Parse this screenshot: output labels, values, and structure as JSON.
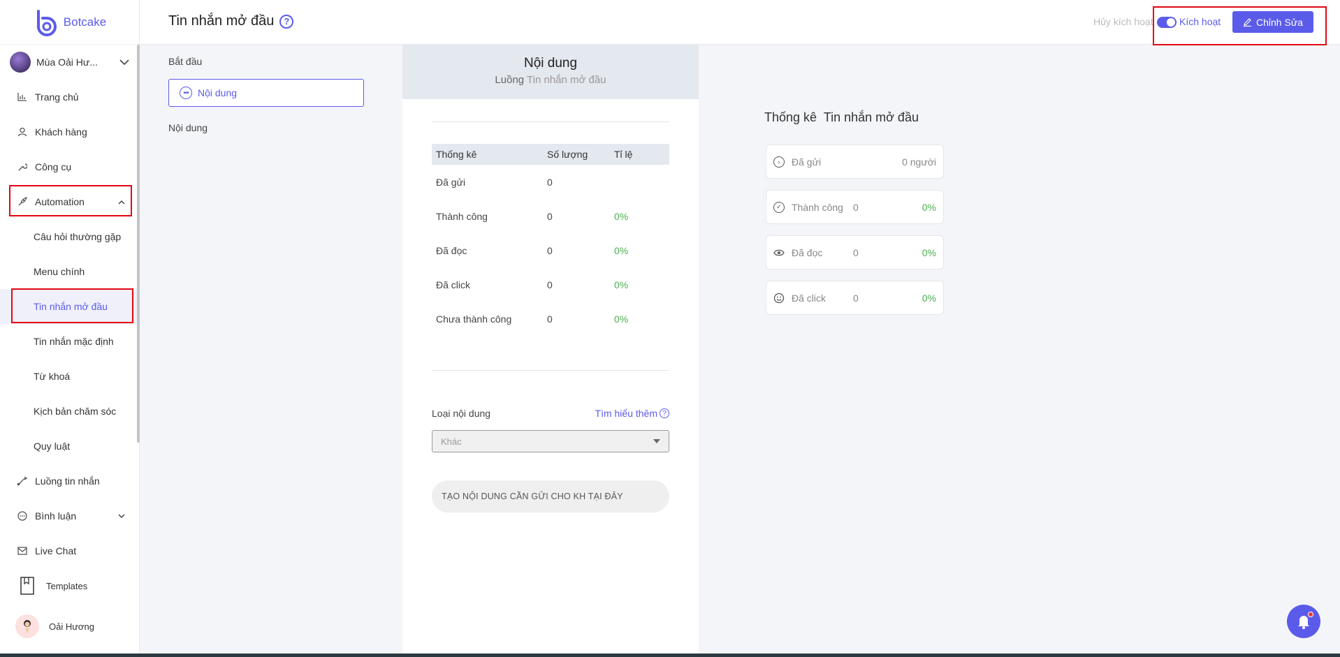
{
  "brand": {
    "name": "Botcake"
  },
  "page_selector": {
    "name": "Mùa Oải Hư..."
  },
  "nav": {
    "home": "Trang chủ",
    "customers": "Khách hàng",
    "tools": "Công cụ",
    "automation": "Automation",
    "automation_children": [
      "Câu hỏi thường gặp",
      "Menu chính",
      "Tin nhắn mở đầu",
      "Tin nhắn mặc định",
      "Từ khoá",
      "Kịch bản chăm sóc",
      "Quy luật"
    ],
    "flows": "Luồng tin nhắn",
    "comments": "Bình luận",
    "livechat": "Live Chat",
    "templates": "Templates",
    "user": "Oải Hương"
  },
  "header": {
    "title": "Tin nhắn mở đầu",
    "help": "?",
    "deactivate": "Hủy kích hoạt",
    "activate": "Kích hoạt",
    "edit": "Chỉnh Sửa"
  },
  "steps": {
    "start": "Bắt đầu",
    "content_box": "Nội dung",
    "content_sub": "Nội dung"
  },
  "center": {
    "title": "Nội dung",
    "subtitle_prefix": "Luồng",
    "subtitle_flow": "Tin nhắn mở đầu",
    "table": {
      "headers": [
        "Thống kê",
        "Số lượng",
        "Tỉ lệ"
      ],
      "rows": [
        {
          "label": "Đã gửi",
          "count": "0",
          "rate": ""
        },
        {
          "label": "Thành công",
          "count": "0",
          "rate": "0%"
        },
        {
          "label": "Đã đọc",
          "count": "0",
          "rate": "0%"
        },
        {
          "label": "Đã click",
          "count": "0",
          "rate": "0%"
        },
        {
          "label": "Chưa thành công",
          "count": "0",
          "rate": "0%"
        }
      ]
    },
    "content_type_label": "Loại nội dung",
    "learn_more": "Tìm hiểu thêm",
    "select_value": "Khác",
    "create_prompt": "TẠO NỘI DUNG CẦN GỬI CHO KH TẠI ĐÂY"
  },
  "right": {
    "title_prefix": "Thống kê",
    "title_flow": "Tin nhắn mở đầu",
    "cards": [
      {
        "label": "Đã gửi",
        "value": "0 người",
        "icon": "send-icon"
      },
      {
        "label": "Thành công",
        "value": "0",
        "pct": "0%",
        "icon": "check-circle-icon"
      },
      {
        "label": "Đã đọc",
        "value": "0",
        "pct": "0%",
        "icon": "eye-icon"
      },
      {
        "label": "Đã click",
        "value": "0",
        "pct": "0%",
        "icon": "smile-icon"
      }
    ]
  },
  "colors": {
    "accent": "#5b5bea",
    "success": "#4caf50",
    "highlight": "#e30613"
  }
}
